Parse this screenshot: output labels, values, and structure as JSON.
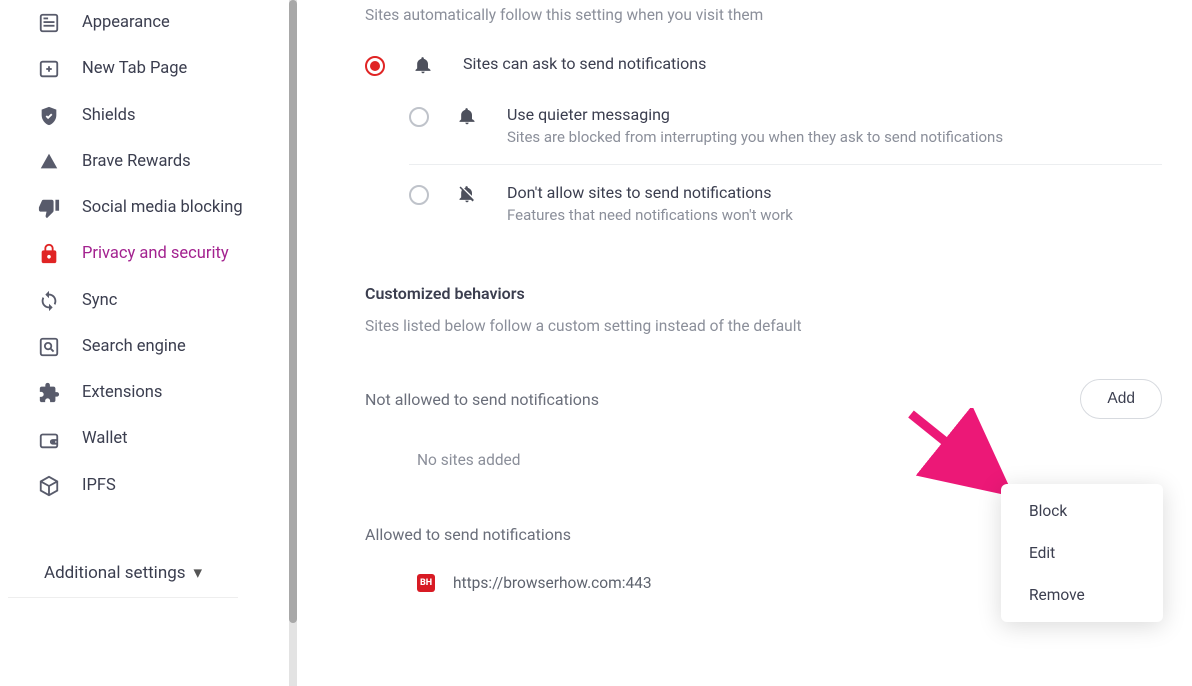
{
  "sidebar": {
    "items": [
      {
        "label": "Appearance"
      },
      {
        "label": "New Tab Page"
      },
      {
        "label": "Shields"
      },
      {
        "label": "Brave Rewards"
      },
      {
        "label": "Social media blocking"
      },
      {
        "label": "Privacy and security"
      },
      {
        "label": "Sync"
      },
      {
        "label": "Search engine"
      },
      {
        "label": "Extensions"
      },
      {
        "label": "Wallet"
      },
      {
        "label": "IPFS"
      }
    ],
    "additional": "Additional settings"
  },
  "main": {
    "default_desc": "Sites automatically follow this setting when you visit them",
    "options": [
      {
        "title": "Sites can ask to send notifications",
        "sub": ""
      },
      {
        "title": "Use quieter messaging",
        "sub": "Sites are blocked from interrupting you when they ask to send notifications"
      },
      {
        "title": "Don't allow sites to send notifications",
        "sub": "Features that need notifications won't work"
      }
    ],
    "customized_heading": "Customized behaviors",
    "customized_sub": "Sites listed below follow a custom setting instead of the default",
    "not_allowed_heading": "Not allowed to send notifications",
    "add_label": "Add",
    "no_sites_text": "No sites added",
    "allowed_heading": "Allowed to send notifications",
    "allowed_sites": [
      {
        "favicon_text": "BH",
        "url": "https://browserhow.com:443"
      }
    ]
  },
  "context_menu": {
    "items": [
      "Block",
      "Edit",
      "Remove"
    ]
  }
}
